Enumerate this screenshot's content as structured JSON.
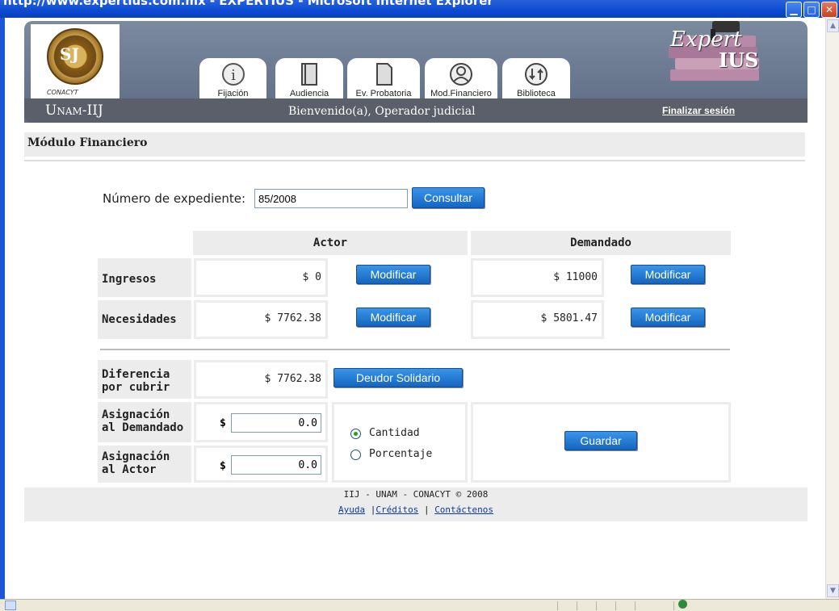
{
  "window": {
    "title": "http://www.expertius.com.mx - EXPERTIUS - Microsoft Internet Explorer"
  },
  "header": {
    "tabs": [
      {
        "label": "Fijación",
        "icon": "info-icon"
      },
      {
        "label": "Audiencia",
        "icon": "book-icon"
      },
      {
        "label": "Ev. Probatoria",
        "icon": "document-icon"
      },
      {
        "label": "Mod.Financiero",
        "icon": "user-icon"
      },
      {
        "label": "Biblioteca",
        "icon": "refresh-icon"
      }
    ],
    "logo_expert": "Expert",
    "logo_ius": "IUS",
    "brand": "Unam-IIJ",
    "welcome": "Bienvenido(a), Operador judicial",
    "logout": "Finalizar sesión"
  },
  "module": {
    "title": "Módulo Financiero"
  },
  "search": {
    "label": "Número de expediente:",
    "value": "85/2008",
    "button": "Consultar"
  },
  "table": {
    "col_actor": "Actor",
    "col_demandado": "Demandado",
    "rows": [
      {
        "label": "Ingresos",
        "actor": "$ 0",
        "demandado": "$ 11000",
        "button": "Modificar"
      },
      {
        "label": "Necesidades",
        "actor": "$ 7762.38",
        "demandado": "$ 5801.47",
        "button": "Modificar"
      }
    ]
  },
  "difference": {
    "label": "Diferencia por cubrir",
    "value": "$ 7762.38",
    "button": "Deudor Solidario"
  },
  "assignment": {
    "demandado_label": "Asignación al Demandado",
    "actor_label": "Asignación al Actor",
    "currency": "$",
    "demandado_value": "0.0",
    "actor_value": "0.0",
    "option_amount": "Cantidad",
    "option_percent": "Porcentaje",
    "selected": "Cantidad",
    "save_button": "Guardar"
  },
  "footer": {
    "copyright": "IIJ - UNAM - CONACYT © 2008",
    "help": "Ayuda",
    "credits": "Créditos",
    "contact": "Contáctenos"
  }
}
